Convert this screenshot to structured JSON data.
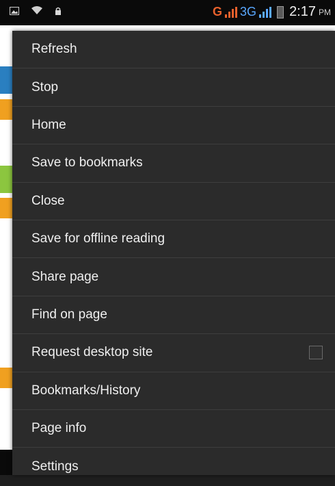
{
  "status_bar": {
    "network_g": "G",
    "network_3g": "3G",
    "time": "2:17",
    "ampm": "PM"
  },
  "menu": {
    "items": [
      {
        "label": "Refresh"
      },
      {
        "label": "Stop"
      },
      {
        "label": "Home"
      },
      {
        "label": "Save to bookmarks"
      },
      {
        "label": "Close"
      },
      {
        "label": "Save for offline reading"
      },
      {
        "label": "Share page"
      },
      {
        "label": "Find on page"
      },
      {
        "label": "Request desktop site",
        "checked": false
      },
      {
        "label": "Bookmarks/History"
      },
      {
        "label": "Page info"
      },
      {
        "label": "Settings"
      }
    ]
  },
  "colors": {
    "menu_bg": "#2b2b2b",
    "divider": "#3e3e3e",
    "status_g": "#e8612c",
    "status_3g": "#5aa8ff"
  },
  "icons": [
    "image-icon",
    "wifi-icon",
    "lock-icon",
    "signal-icon",
    "battery-icon"
  ]
}
